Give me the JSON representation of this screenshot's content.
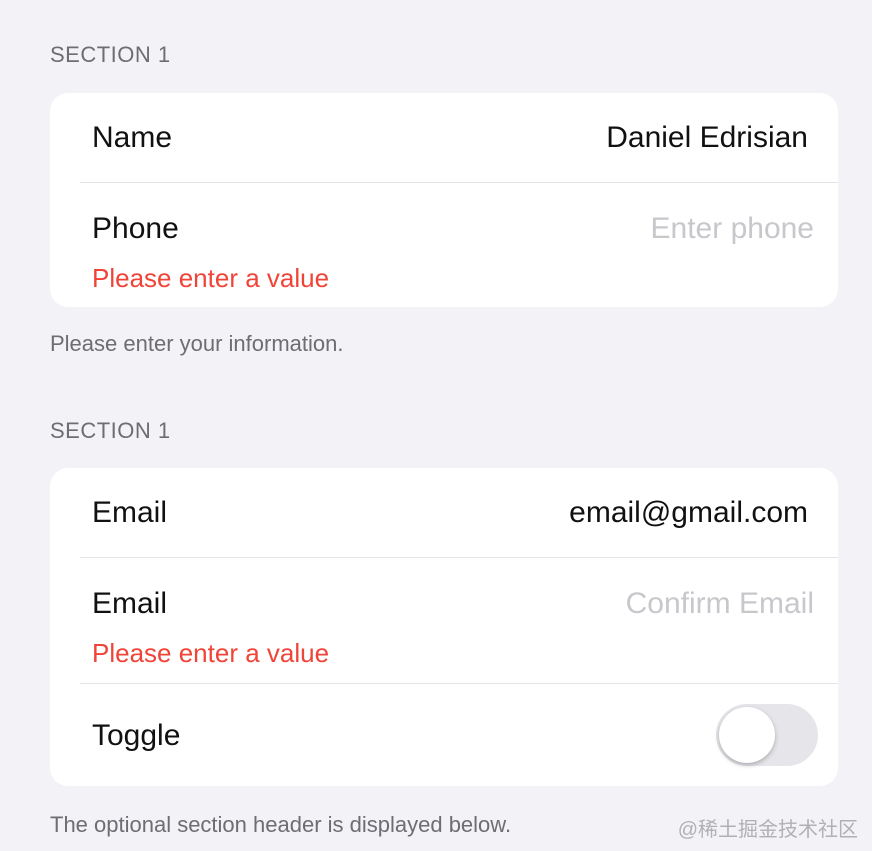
{
  "section1": {
    "header": "SECTION 1",
    "rows": {
      "name": {
        "label": "Name",
        "value": "Daniel Edrisian"
      },
      "phone": {
        "label": "Phone",
        "placeholder": "Enter phone",
        "error": "Please enter a value"
      }
    },
    "footer": "Please enter your information."
  },
  "section2": {
    "header": "SECTION 1",
    "rows": {
      "email": {
        "label": "Email",
        "value": "email@gmail.com"
      },
      "confirm_email": {
        "label": "Email",
        "placeholder": "Confirm Email",
        "error": "Please enter a value"
      },
      "toggle": {
        "label": "Toggle",
        "state": "off"
      }
    },
    "footer": "The optional section header is displayed below."
  },
  "watermark": "@稀土掘金技术社区",
  "colors": {
    "background": "#f2f2f7",
    "card": "#ffffff",
    "error": "#f04438",
    "placeholder": "#c7c7cc",
    "secondary_text": "#6d6d72"
  }
}
